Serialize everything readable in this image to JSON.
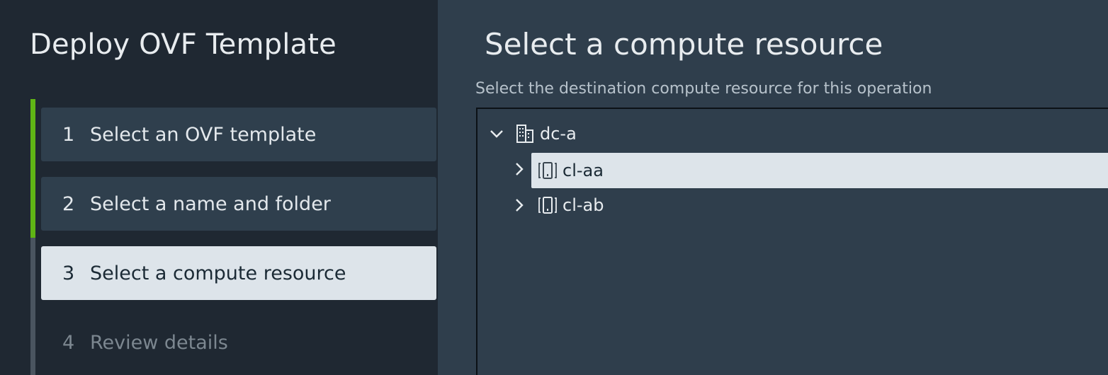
{
  "wizard": {
    "title": "Deploy OVF Template",
    "steps": [
      {
        "num": "1",
        "label": "Select an OVF template",
        "state": "done"
      },
      {
        "num": "2",
        "label": "Select a name and folder",
        "state": "done"
      },
      {
        "num": "3",
        "label": "Select a compute resource",
        "state": "active"
      },
      {
        "num": "4",
        "label": "Review details",
        "state": "todo"
      }
    ],
    "colors": {
      "progress": "#60b515",
      "active_step_bg": "#dde4ea"
    }
  },
  "main": {
    "title": "Select a compute resource",
    "subtitle": "Select the destination compute resource for this operation",
    "tree": {
      "root": {
        "label": "dc-a",
        "icon": "datacenter-icon",
        "expanded": true
      },
      "children": [
        {
          "label": "cl-aa",
          "icon": "cluster-icon",
          "expanded": false,
          "selected": true
        },
        {
          "label": "cl-ab",
          "icon": "cluster-icon",
          "expanded": false,
          "selected": false
        }
      ]
    }
  }
}
